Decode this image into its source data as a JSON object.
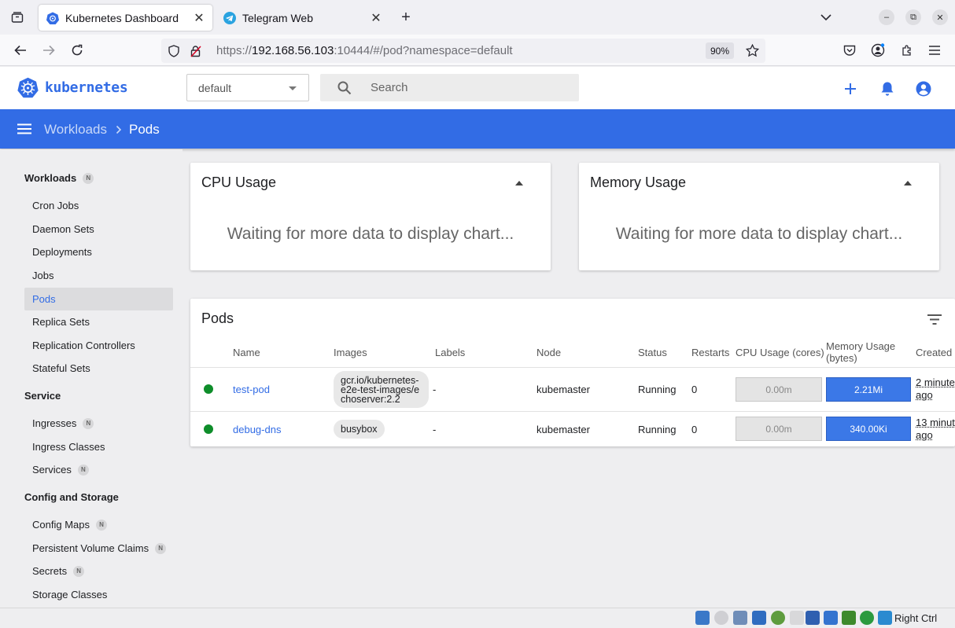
{
  "browser": {
    "tabs": [
      {
        "title": "Kubernetes Dashboard",
        "active": true
      },
      {
        "title": "Telegram Web",
        "active": false
      }
    ],
    "url": {
      "scheme": "https://",
      "host": "192.168.56.103",
      "rest": ":10444/#/pod?namespace=default"
    },
    "zoom": "90%"
  },
  "app": {
    "brand": "kubernetes",
    "namespace": "default",
    "search_placeholder": "Search",
    "accent": "#326ce5"
  },
  "breadcrumb": {
    "parent": "Workloads",
    "current": "Pods"
  },
  "sidebar": {
    "workloads": {
      "title": "Workloads",
      "badge": "N",
      "items": [
        "Cron Jobs",
        "Daemon Sets",
        "Deployments",
        "Jobs",
        "Pods",
        "Replica Sets",
        "Replication Controllers",
        "Stateful Sets"
      ],
      "selected": "Pods"
    },
    "service": {
      "title": "Service",
      "items": [
        {
          "label": "Ingresses",
          "badge": "N"
        },
        {
          "label": "Ingress Classes",
          "badge": ""
        },
        {
          "label": "Services",
          "badge": "N"
        }
      ]
    },
    "config": {
      "title": "Config and Storage",
      "items": [
        {
          "label": "Config Maps",
          "badge": "N"
        },
        {
          "label": "Persistent Volume Claims",
          "badge": "N"
        },
        {
          "label": "Secrets",
          "badge": "N"
        },
        {
          "label": "Storage Classes",
          "badge": ""
        }
      ]
    }
  },
  "cpu_card": {
    "title": "CPU Usage",
    "message": "Waiting for more data to display chart..."
  },
  "memory_card": {
    "title": "Memory Usage",
    "message": "Waiting for more data to display chart..."
  },
  "pods": {
    "title": "Pods",
    "columns": [
      "Name",
      "Images",
      "Labels",
      "Node",
      "Status",
      "Restarts",
      "CPU Usage (cores)",
      "Memory Usage (bytes)",
      "Created"
    ],
    "rows": [
      {
        "name": "test-pod",
        "image": "gcr.io/kubernetes-e2e-test-images/echoserver:2.2",
        "image_lines": [
          "gcr.io/kubernetes-",
          "e2e-test-images/e",
          "choserver:2.2"
        ],
        "labels": "-",
        "node": "kubemaster",
        "status": "Running",
        "restarts": "0",
        "cpu": "0.00m",
        "memory": "2.21Mi",
        "created_lines": [
          "2 minute",
          "ago"
        ]
      },
      {
        "name": "debug-dns",
        "image": "busybox",
        "image_lines": [
          "busybox"
        ],
        "labels": "-",
        "node": "kubemaster",
        "status": "Running",
        "restarts": "0",
        "cpu": "0.00m",
        "memory": "340.00Ki",
        "created_lines": [
          "13 minut",
          "ago"
        ]
      }
    ]
  },
  "vbox": {
    "host_key": "Right Ctrl"
  }
}
